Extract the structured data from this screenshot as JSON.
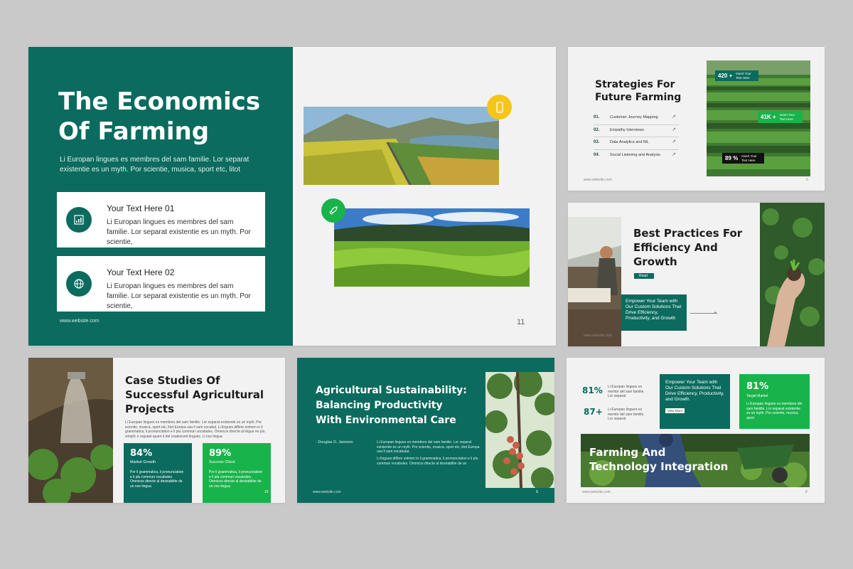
{
  "colors": {
    "teal": "#0a6b5e",
    "green": "#18b34a",
    "yellow": "#f5c518",
    "light": "#f2f2f2"
  },
  "s11": {
    "title": "The Economics Of Farming",
    "body": "Li Europan lingues es membres del sam familie. Lor separat existentie es un myth. Por scientie, musica, sport etc, litot",
    "card1": {
      "title": "Your Text Here 01",
      "text": "Li Europan lingues es membres del sam familie. Lor separat existentie es un myth. Por scientie,",
      "icon": "chart-icon"
    },
    "card2": {
      "title": "Your Text Here 02",
      "text": "Li Europan lingues es membres del sam familie. Lor separat existentie es un myth. Por scientie,",
      "icon": "globe-icon"
    },
    "website": "www.website.com",
    "page": "11"
  },
  "s6": {
    "title_line1": "Strategies For",
    "title_line2": "Future Farming",
    "items": [
      {
        "num": "01.",
        "label": "Customer Journey Mapping"
      },
      {
        "num": "02.",
        "label": "Empathy Interviews"
      },
      {
        "num": "03.",
        "label": "Data Analytics and ML"
      },
      {
        "num": "04.",
        "label": "Social Listening and Analysis"
      }
    ],
    "stats": [
      {
        "value": "420 +",
        "label": "Insert Your Text Here"
      },
      {
        "value": "41K +",
        "label": "Insert Your Text Here"
      },
      {
        "value": "89 %",
        "label": "Insert Your Text Here"
      }
    ],
    "website": "www.website.com",
    "page": "6"
  },
  "s7": {
    "title_line1": "Best Practices For",
    "title_line2": "Efficiency And",
    "title_line3": "Growth",
    "read": "Read",
    "box_text": "Empower Your Team with Our Custom Solutions That Drive Efficiency, Productivity, and Growth",
    "website": "www.website.com",
    "page": "7"
  },
  "s10": {
    "title_line1": "Case Studies Of",
    "title_line2": "Successful Agricultural",
    "title_line3": "Projects",
    "body": "Li Europan lingues es membres del sam familie. Lor separat existentie es un myth. Por scientie, musica, sport etc, litot Europa usa li sam vocabul. Li lingues differe solmen in li grammatica, li pronunciation e li plu commun vocabules. Omnicos directe al lingue es plu simplic e regulari quam ti del coalescent lingues. Li nov lingua",
    "stat1": {
      "value": "84%",
      "label": "Market Growth",
      "text": "Por li grammatica, li pronunciation e li plu commun vocabules. Omnicos directe al desirabilite de un nov lingua"
    },
    "stat2": {
      "value": "89%",
      "label": "Success Client",
      "text": "Por li grammatica, li pronunciation e li plu commun vocabules. Omnicos directe al desirabilite de un nov lingua"
    },
    "page": "10"
  },
  "s9": {
    "title_line1": "Agricultural Sustainability:",
    "title_line2": "Balancing Productivity",
    "title_line3": "With Environmental Care",
    "author": "- Douglas D. Jamison",
    "body1": "Li Europan lingues es membres del sam familie. Lor separat existentie es un myth. Por scientie, musica, sport etc, litot Europa usa li sam vocabular.",
    "body2": "Li lingues differe solmen in li grammatica, li pronunciation e li plu commun vocabules. Omnicos directe al desirabilite de un",
    "website": "www.website.com",
    "page": "9"
  },
  "s8": {
    "stat1": {
      "value": "81%",
      "text": "Li Europan lingues es membr del sam familie. Lor separat"
    },
    "stat2": {
      "value": "87+",
      "text": "Li Europan lingues es membr del sam familie. Lor separat"
    },
    "box_text": "Empower Your Team with Our Custom Solutions That Drive Efficiency, Productivity, and Growth",
    "view_more": "View More",
    "green_stat": {
      "value": "81%",
      "label": "Target Market",
      "text": "Li Europan lingues es membres del sam familie. Lor separat existentie es un myth. Por scientie, musica, sport"
    },
    "banner_line1": "Farming And",
    "banner_line2": "Technology Integration",
    "website": "www.website.com",
    "page": "8"
  }
}
